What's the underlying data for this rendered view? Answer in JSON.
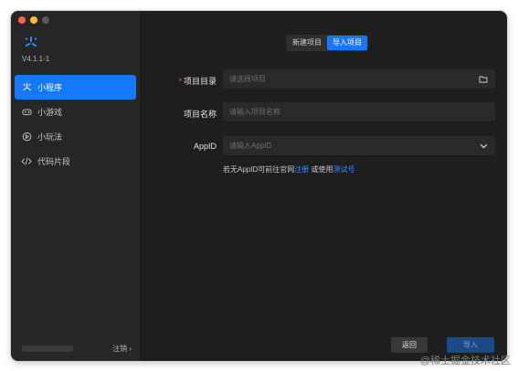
{
  "app": {
    "version": "V4.1.1-1"
  },
  "sidebar": {
    "items": [
      {
        "label": "小程序",
        "icon": "mini-program-icon",
        "active": true
      },
      {
        "label": "小游戏",
        "icon": "gamepad-icon",
        "active": false
      },
      {
        "label": "小玩法",
        "icon": "play-circle-icon",
        "active": false
      },
      {
        "label": "代码片段",
        "icon": "code-icon",
        "active": false
      }
    ],
    "footer": {
      "logout": "注销 ›"
    }
  },
  "tabs": {
    "new_project": "新建项目",
    "import_project": "导入项目",
    "active": "import_project"
  },
  "form": {
    "directory": {
      "required_mark": "*",
      "label": "项目目录",
      "placeholder": "请选择项目",
      "icon": "folder-icon"
    },
    "name": {
      "label": "项目名称",
      "placeholder": "请输入项目名称"
    },
    "appid": {
      "label": "AppID",
      "placeholder": "请输入AppID",
      "icon": "chevron-down-icon"
    },
    "hint": {
      "prefix": "若无AppID可前往官网",
      "register_link": "注册",
      "middle": "或使用",
      "test_link": "测试号"
    }
  },
  "footer": {
    "back": "返回",
    "import": "导入"
  },
  "watermark": "@稀土掘金技术社区",
  "colors": {
    "accent": "#1677ff",
    "link": "#3b8cff",
    "required": "#ff4d4f",
    "background": "#1e1e1e",
    "sidebar": "#262626"
  }
}
